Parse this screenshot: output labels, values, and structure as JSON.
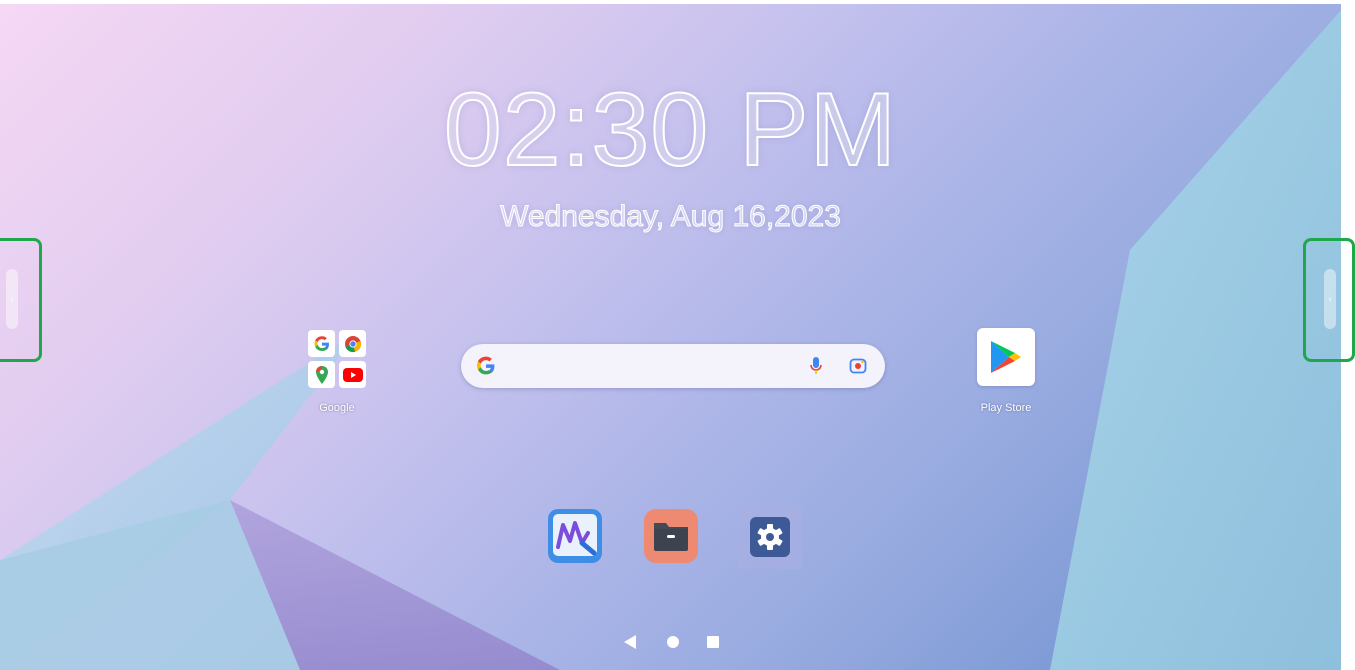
{
  "home": {
    "time": "02:30 PM",
    "date": "Wednesday, Aug 16,2023"
  },
  "apps": {
    "google_folder": {
      "label": "Google",
      "items": [
        "google-icon",
        "chrome-icon",
        "maps-icon",
        "youtube-icon"
      ]
    },
    "play_store": {
      "label": "Play Store",
      "icon": "play-store-icon"
    }
  },
  "search": {
    "logo": "G",
    "icons": [
      "google-logo-icon",
      "microphone-icon",
      "lens-camera-icon"
    ]
  },
  "dock": {
    "apps": [
      "whiteboard-app-icon",
      "file-manager-icon",
      "settings-icon"
    ]
  },
  "navigation": {
    "buttons": [
      "back-icon",
      "home-icon",
      "recents-icon"
    ]
  },
  "colors": {
    "highlight": "#1fa84a",
    "settings_bg": "#3e5a96",
    "files_bg": "#ee8a72"
  }
}
